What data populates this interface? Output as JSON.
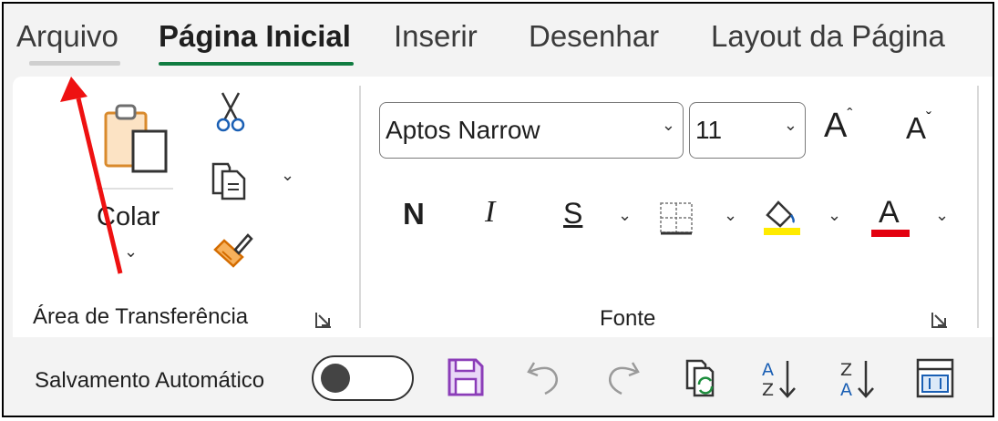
{
  "tabs": [
    {
      "label": "Arquivo"
    },
    {
      "label": "Página Inicial"
    },
    {
      "label": "Inserir"
    },
    {
      "label": "Desenhar"
    },
    {
      "label": "Layout da Página"
    }
  ],
  "clipboard": {
    "paste_label": "Colar",
    "group_label": "Área de Transferência"
  },
  "font": {
    "font_name": "Aptos Narrow",
    "font_size": "11",
    "bold_label": "N",
    "italic_label": "I",
    "underline_label": "S",
    "color_label": "A",
    "grow_label": "A",
    "shrink_label": "A",
    "group_label": "Fonte",
    "highlight_color": "#ffeb00",
    "font_color": "#e3000f"
  },
  "quick_access": {
    "autosave_label": "Salvamento Automático"
  }
}
